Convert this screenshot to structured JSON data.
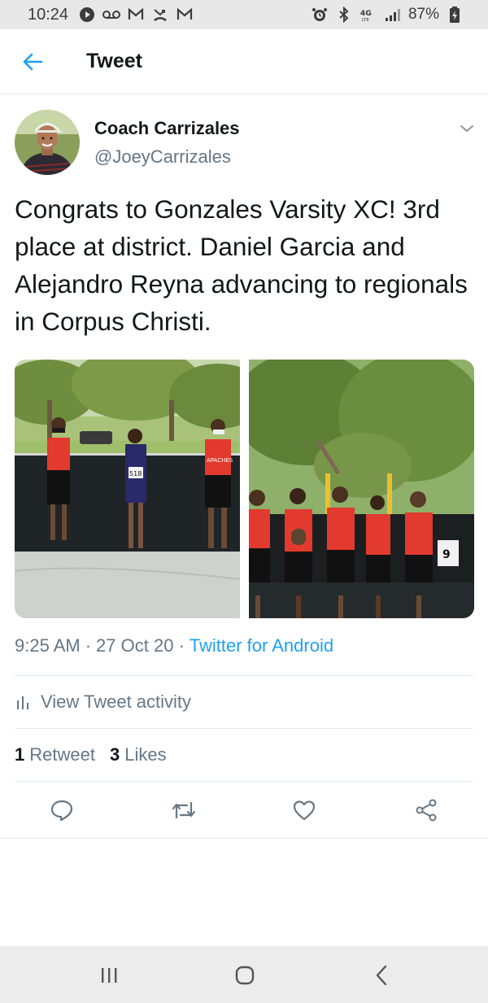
{
  "status_bar": {
    "time": "10:24",
    "left_icons": [
      "play-icon",
      "voicemail-icon",
      "gmail-icon",
      "missed-call-icon",
      "gmail-icon"
    ],
    "right_icons": [
      "alarm-icon",
      "bluetooth-icon",
      "4g-lte-icon",
      "signal-icon"
    ],
    "battery": "87%"
  },
  "header": {
    "title": "Tweet"
  },
  "tweet": {
    "author_name": "Coach Carrizales",
    "author_handle": "@JoeyCarrizales",
    "text": "Congrats to Gonzales Varsity XC! 3rd place at district. Daniel Garcia and Alejandro Reyna advancing to regionals in Corpus Christi.",
    "time": "9:25 AM",
    "date": "27 Oct 20",
    "separator": "·",
    "source": "Twitter for Android",
    "activity_label": "View Tweet activity",
    "retweets_count": "1",
    "retweets_label": "Retweet",
    "likes_count": "3",
    "likes_label": "Likes"
  },
  "photos": {
    "left_bib": "518",
    "left_jersey": "APACHES",
    "right_sign": "9"
  },
  "actions": [
    "reply-icon",
    "retweet-icon",
    "like-icon",
    "share-icon"
  ],
  "colors": {
    "accent": "#1da1f2",
    "text": "#14171a",
    "secondary": "#657786",
    "divider": "#e1e8ed"
  }
}
